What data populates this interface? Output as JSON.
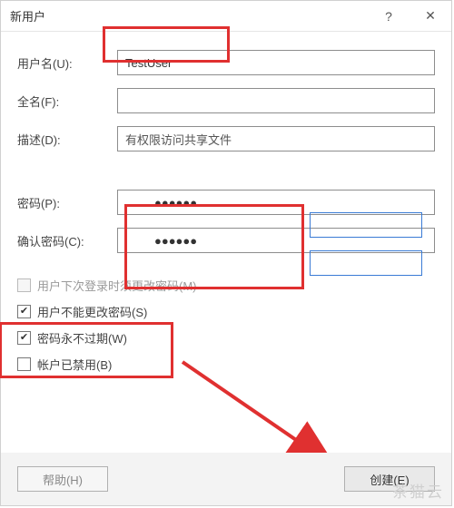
{
  "titlebar": {
    "title": "新用户",
    "help_icon": "?",
    "close_icon": "✕"
  },
  "fields": {
    "username_label": "用户名(U):",
    "username_value": "TestUser",
    "fullname_label": "全名(F):",
    "fullname_value": "",
    "description_label": "描述(D):",
    "description_value": "有权限访问共享文件",
    "password_label": "密码(P):",
    "password_value": "●●●●●●",
    "confirm_label": "确认密码(C):",
    "confirm_value": "●●●●●●"
  },
  "checkboxes": {
    "must_change_label": "用户下次登录时须更改密码(M)",
    "cannot_change_label": "用户不能更改密码(S)",
    "never_expire_label": "密码永不过期(W)",
    "disabled_label": "帐户已禁用(B)"
  },
  "buttons": {
    "help_label": "帮助(H)",
    "create_label": "创建(E)"
  },
  "watermark": "茶猫云"
}
